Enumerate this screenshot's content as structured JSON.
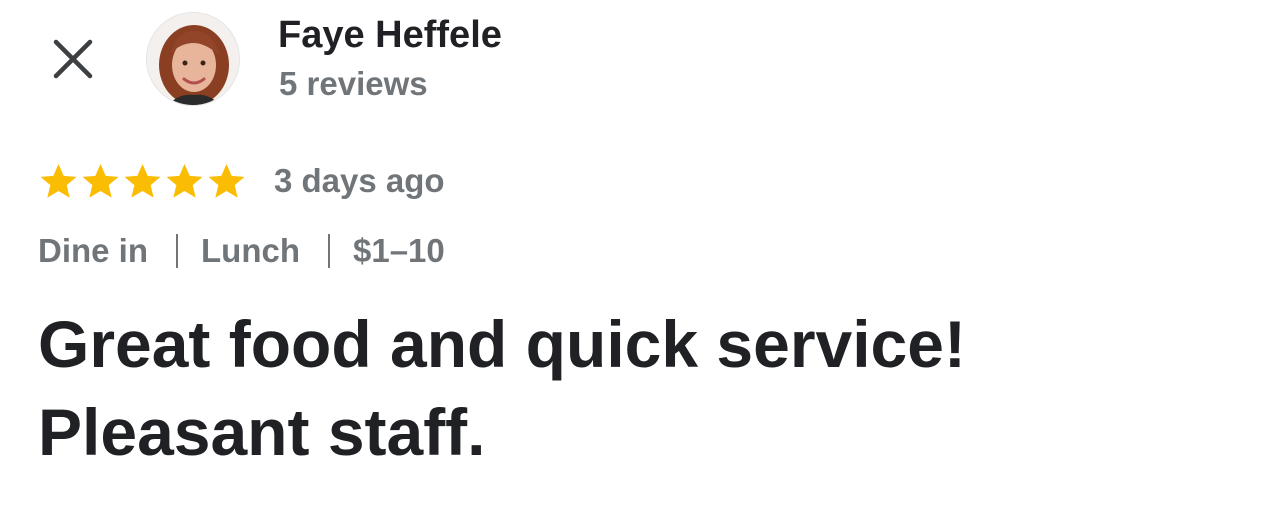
{
  "header": {
    "close_icon": "close-icon",
    "author_name": "Faye Heffele",
    "review_count": "5 reviews",
    "avatar": "avatar-photo"
  },
  "rating": {
    "stars": 5,
    "max_stars": 5,
    "star_color": "#fbbc04",
    "icon": "star-icon",
    "date": "3 days ago"
  },
  "tags": [
    "Dine in",
    "Lunch",
    "$1–10"
  ],
  "review": {
    "lines": [
      "Great food and quick service!",
      "Pleasant staff."
    ]
  },
  "colors": {
    "primary_text": "#202124",
    "secondary_text": "#70757a",
    "background": "#ffffff"
  }
}
